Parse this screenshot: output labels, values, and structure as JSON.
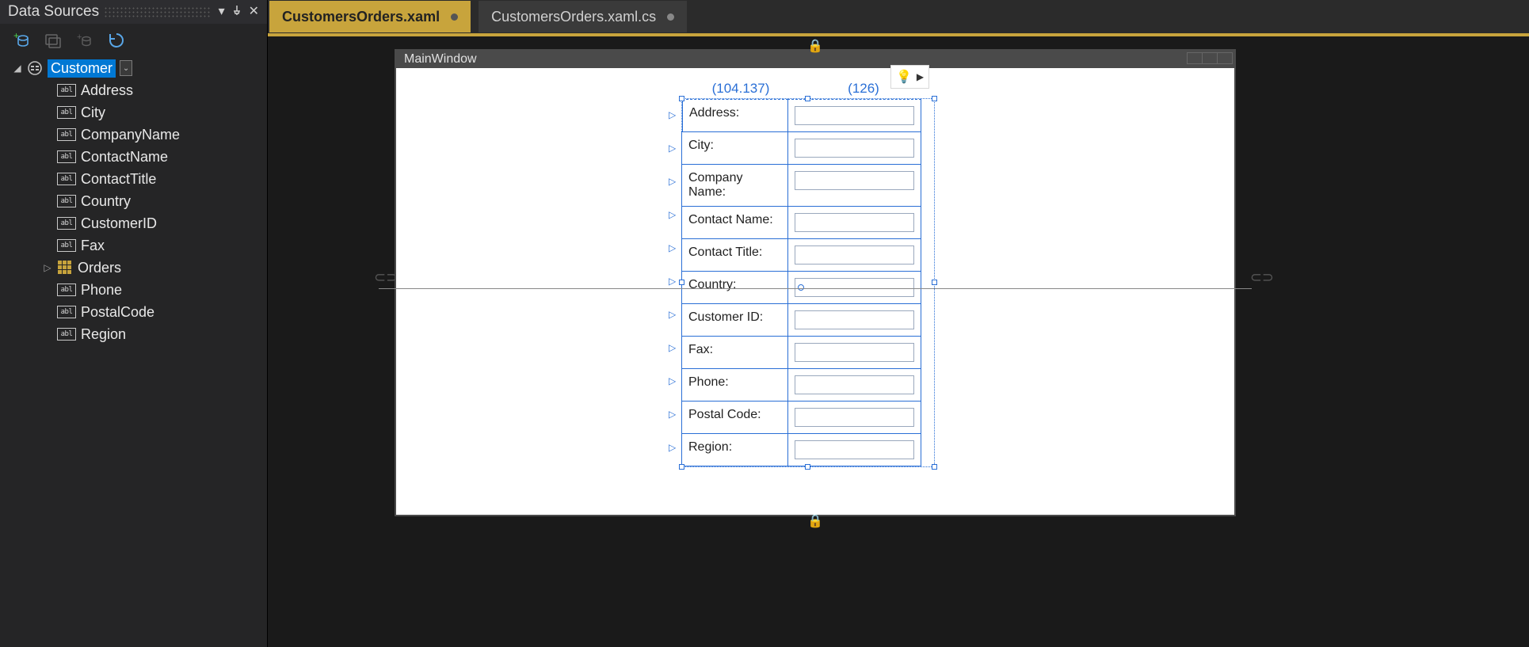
{
  "panel": {
    "title": "Data Sources",
    "root": {
      "label": "Customer",
      "expanded": true
    },
    "fields": [
      "Address",
      "City",
      "CompanyName",
      "ContactName",
      "ContactTitle",
      "Country",
      "CustomerID",
      "Fax"
    ],
    "orders": {
      "label": "Orders"
    },
    "fields2": [
      "Phone",
      "PostalCode",
      "Region"
    ]
  },
  "tabs": {
    "active": {
      "label": "CustomersOrders.xaml"
    },
    "inactive": {
      "label": "CustomersOrders.xaml.cs"
    }
  },
  "designer": {
    "windowTitle": "MainWindow",
    "col1Width": "(104.137)",
    "col2Width": "(126)",
    "rows": [
      {
        "label": "Address:"
      },
      {
        "label": "City:"
      },
      {
        "label": "Company Name:"
      },
      {
        "label": "Contact Name:"
      },
      {
        "label": "Contact Title:"
      },
      {
        "label": "Country:"
      },
      {
        "label": "Customer ID:"
      },
      {
        "label": "Fax:"
      },
      {
        "label": "Phone:"
      },
      {
        "label": "Postal Code:"
      },
      {
        "label": "Region:"
      }
    ]
  }
}
